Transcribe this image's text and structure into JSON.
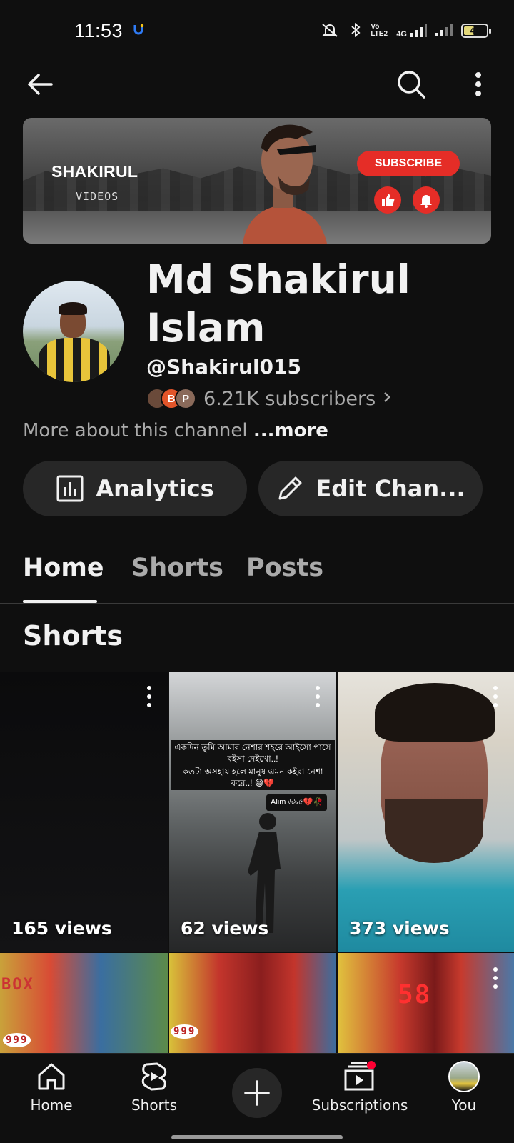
{
  "status_bar": {
    "time": "11:53",
    "network_label": "4G",
    "volte_label": "Vo LTE2",
    "battery_level": "40"
  },
  "banner": {
    "title": "SHAKIRUL",
    "subtitle": "VIDEOS",
    "subscribe_label": "SUBSCRIBE"
  },
  "channel": {
    "name": "Md Shakirul Islam",
    "handle": "@Shakirul015",
    "subscribers": "6.21K subscribers",
    "subscriber_avatar_letters": [
      "",
      "B",
      "P"
    ],
    "about_text": "More about this channel",
    "about_more": "...more"
  },
  "actions": {
    "analytics_label": "Analytics",
    "edit_label": "Edit Chan..."
  },
  "tabs": [
    {
      "label": "Home",
      "active": true
    },
    {
      "label": "Shorts",
      "active": false
    },
    {
      "label": "Posts",
      "active": false
    }
  ],
  "section": {
    "title": "Shorts"
  },
  "shorts": [
    {
      "views": "165 views"
    },
    {
      "views": "62 views",
      "captions": [
        "একদিন তুমি আমার নেশার শহরে আইসো পাসে বইসা দেইখো..!",
        "কতটা অসহায় হলে মানুষ এমন কইরা নেশা করে..! 😅💔"
      ],
      "tag": "Alim ৬৯৫💔🥀"
    },
    {
      "views": "373 views"
    }
  ],
  "shorts_row2": [
    {
      "sign": "BOX",
      "display": "999"
    },
    {
      "display": "999"
    },
    {
      "display": "58"
    }
  ],
  "bottom_nav": {
    "home": "Home",
    "shorts": "Shorts",
    "subscriptions": "Subscriptions",
    "you": "You"
  },
  "colors": {
    "background": "#0f0f0f",
    "surface": "#272727",
    "accent_red": "#e52d27",
    "text_primary": "#f1f1f1",
    "text_secondary": "#aaaaaa"
  }
}
